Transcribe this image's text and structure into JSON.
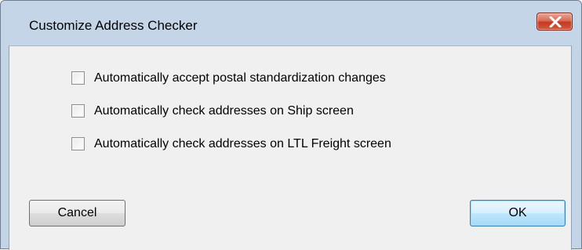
{
  "window": {
    "title": "Customize Address Checker",
    "close_icon": "close-icon"
  },
  "options": [
    {
      "label": "Automatically accept postal standardization changes",
      "checked": false
    },
    {
      "label": "Automatically check addresses on Ship screen",
      "checked": false
    },
    {
      "label": "Automatically check addresses on LTL Freight screen",
      "checked": false
    }
  ],
  "buttons": {
    "cancel_label": "Cancel",
    "ok_label": "OK"
  },
  "colors": {
    "titlebar": "#c4d5e7",
    "client": "#f0f0f0",
    "close_button": "#c4391f",
    "default_button": "#bee6fd"
  }
}
